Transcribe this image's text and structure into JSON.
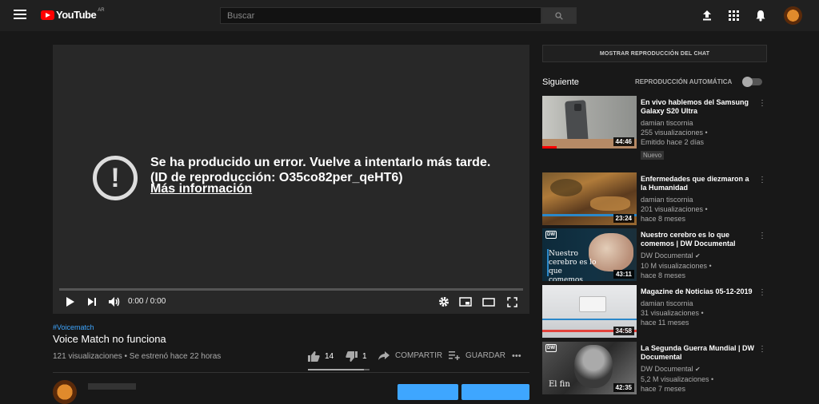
{
  "header": {
    "logo_text": "YouTube",
    "logo_country": "AR",
    "search_placeholder": "Buscar"
  },
  "player": {
    "error_message": "Se ha producido un error. Vuelve a intentarlo más tarde. (ID de reproducción: O35co82per_qeHT6)",
    "error_link": "Más información",
    "timecode": "0:00 / 0:00",
    "progress": 0
  },
  "video": {
    "hashtag": "#Voicematch",
    "title": "Voice Match no funciona",
    "meta": "121 visualizaciones • Se estrenó hace 22 horas",
    "likes": "14",
    "dislikes": "1",
    "share_label": "COMPARTIR",
    "save_label": "GUARDAR",
    "more_label": "•••"
  },
  "sidebar": {
    "chat_button": "MOSTRAR REPRODUCCIÓN DEL CHAT",
    "next_label": "Siguiente",
    "autoplay_label": "REPRODUCCIÓN AUTOMÁTICA",
    "autoplay_on": false,
    "recommendations": [
      {
        "title": "En vivo hablemos del Samsung Galaxy S20 Ultra",
        "channel": "damian tiscornia",
        "views": "255 visualizaciones •",
        "age": "Emitido hace 2 días",
        "badge": "Nuevo",
        "duration": "44:46",
        "watched": 0.15
      },
      {
        "title": "Enfermedades que diezmaron a la Humanidad",
        "channel": "damian tiscornia",
        "views": "201 visualizaciones •",
        "age": "hace 8 meses",
        "duration": "23:24",
        "watched": 0
      },
      {
        "title": "Nuestro cerebro es lo que comemos | DW Documental",
        "channel": "DW Documental",
        "verified": "✔",
        "views": "10 M visualizaciones •",
        "age": "hace 8 meses",
        "duration": "43:11",
        "thumb_text": "Nuestro cerebro es lo que comemos",
        "dw": "DW",
        "watched": 0
      },
      {
        "title": "Magazine de Noticias 05-12-2019",
        "channel": "damian tiscornia",
        "views": "31 visualizaciones •",
        "age": "hace 11 meses",
        "duration": "34:58",
        "watched": 0
      },
      {
        "title": "La Segunda Guerra Mundial | DW Documental",
        "channel": "DW Documental",
        "verified": "✔",
        "views": "5,2 M visualizaciones •",
        "age": "hace 7 meses",
        "duration": "42:35",
        "thumb_text": "El fin",
        "dw": "DW",
        "watched": 0
      }
    ]
  },
  "colors": {
    "accent_blue": "#3ea6ff",
    "brand_red": "#ff0000",
    "background": "#181818"
  }
}
